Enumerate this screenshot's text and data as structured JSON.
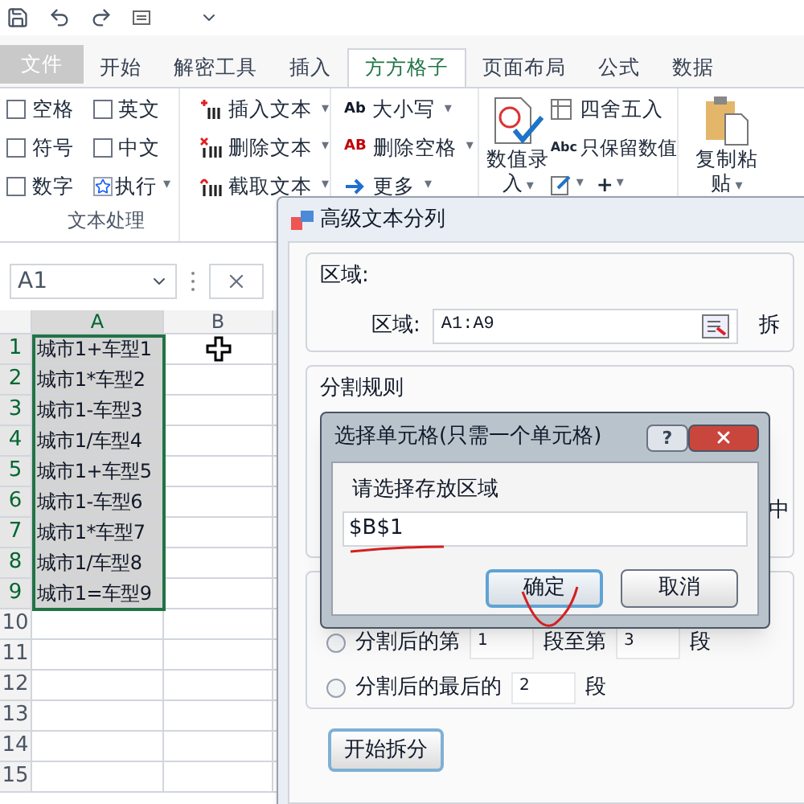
{
  "ribbon_tabs": [
    {
      "label": "文件",
      "kind": "file",
      "selected": false
    },
    {
      "label": "开始",
      "kind": "tab",
      "selected": false
    },
    {
      "label": "解密工具",
      "kind": "tab",
      "selected": false
    },
    {
      "label": "插入",
      "kind": "tab",
      "selected": false
    },
    {
      "label": "方方格子",
      "kind": "tab",
      "selected": true
    },
    {
      "label": "页面布局",
      "kind": "tab",
      "selected": false
    },
    {
      "label": "公式",
      "kind": "tab",
      "selected": false
    },
    {
      "label": "数据",
      "kind": "tab",
      "selected": false
    }
  ],
  "checkboxes": [
    {
      "label": "空格",
      "checked": false
    },
    {
      "label": "英文",
      "checked": false
    },
    {
      "label": "符号",
      "checked": false
    },
    {
      "label": "中文",
      "checked": false
    },
    {
      "label": "数字",
      "checked": false
    }
  ],
  "execute_button": {
    "label": "执行",
    "arrow": "▾"
  },
  "text_tools": [
    {
      "label": "插入文本",
      "arrow": "▾",
      "kind": "insert"
    },
    {
      "label": "删除文本",
      "arrow": "▾",
      "kind": "delete"
    },
    {
      "label": "截取文本",
      "arrow": "▾",
      "kind": "cut"
    }
  ],
  "case_tools": [
    {
      "label": "大小写",
      "icon_text": "Ab",
      "arrow": "▾",
      "kind": "case"
    },
    {
      "label": "删除空格",
      "icon_text": "AB",
      "arrow": "▾",
      "kind": "space"
    },
    {
      "label": "更多",
      "arrow": "▾",
      "kind": "more"
    }
  ],
  "number_tools": {
    "entry": {
      "label": "数值录入",
      "arrow": "▾"
    },
    "round": {
      "label": "四舍五入"
    },
    "keep": {
      "label": "只保留数值",
      "icon_text": "Abc"
    },
    "edit_arrow": "▾",
    "plus": "+",
    "plus_arrow": "▾"
  },
  "paste_button": {
    "label": "复制粘贴",
    "arrow": "▾"
  },
  "group_label": "文本处理",
  "name_box": {
    "value": "A1"
  },
  "sheet": {
    "columns": [
      "A",
      "B"
    ],
    "rows": [
      {
        "number": "1",
        "a": "城市1+车型1"
      },
      {
        "number": "2",
        "a": "城市1*车型2"
      },
      {
        "number": "3",
        "a": "城市1-车型3"
      },
      {
        "number": "4",
        "a": "城市1/车型4"
      },
      {
        "number": "5",
        "a": "城市1+车型5"
      },
      {
        "number": "6",
        "a": "城市1-车型6"
      },
      {
        "number": "7",
        "a": "城市1*车型7"
      },
      {
        "number": "8",
        "a": "城市1/车型8"
      },
      {
        "number": "9",
        "a": "城市1=车型9"
      },
      {
        "number": "10",
        "a": ""
      },
      {
        "number": "11",
        "a": ""
      },
      {
        "number": "12",
        "a": ""
      },
      {
        "number": "13",
        "a": ""
      },
      {
        "number": "14",
        "a": ""
      },
      {
        "number": "15",
        "a": ""
      }
    ]
  },
  "split_dialog": {
    "title": "高级文本分列",
    "area_legend": "区域:",
    "area_label": "区域:",
    "area_value": "A1:A9",
    "area_right": "拆",
    "rules_legend": "分割规则",
    "rules_right": "中",
    "options": [
      {
        "label": "分割后的第",
        "value": "1",
        "middle": "段至第",
        "value2": "3",
        "suffix": "段",
        "selected": false
      },
      {
        "label": "分割后的最后的",
        "value": "2",
        "suffix": "段",
        "selected": false
      }
    ],
    "start_button": "开始拆分"
  },
  "select_dialog": {
    "title": "选择单元格(只需一个单元格)",
    "help": "?",
    "prompt": "请选择存放区域",
    "value": "$B$1",
    "ok": "确定",
    "cancel": "取消"
  }
}
